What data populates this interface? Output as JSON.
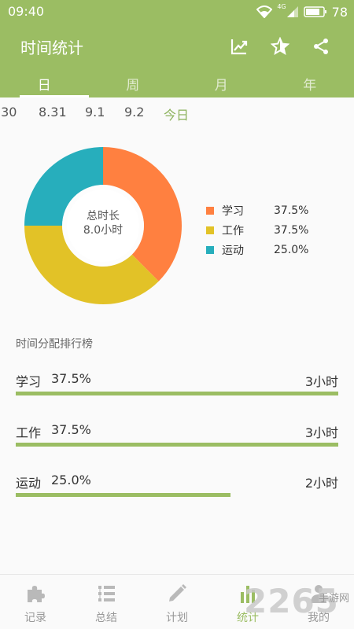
{
  "status_bar": {
    "time": "09:40",
    "network": "4G",
    "battery": "78"
  },
  "app_bar": {
    "title": "时间统计",
    "actions": [
      "trend-chart-icon",
      "star-icon",
      "share-icon"
    ]
  },
  "tabs": [
    {
      "label": "日",
      "active": true
    },
    {
      "label": "周",
      "active": false
    },
    {
      "label": "月",
      "active": false
    },
    {
      "label": "年",
      "active": false
    }
  ],
  "dates": [
    ".30",
    "8.31",
    "9.1",
    "9.2",
    "今日"
  ],
  "colors": {
    "accent": "#9bbd63",
    "study": "#ff8040",
    "work": "#e2c227",
    "sport": "#27aebc"
  },
  "chart_data": {
    "type": "pie",
    "center_label": "总时长",
    "center_value": "8.0小时",
    "slices": [
      {
        "name": "学习",
        "percent": "37.5%",
        "value": 37.5,
        "color": "#ff8040"
      },
      {
        "name": "工作",
        "percent": "37.5%",
        "value": 37.5,
        "color": "#e2c227"
      },
      {
        "name": "运动",
        "percent": "25.0%",
        "value": 25.0,
        "color": "#27aebc"
      }
    ]
  },
  "ranking": {
    "title": "时间分配排行榜",
    "items": [
      {
        "name": "学习",
        "percent": "37.5%",
        "duration": "3小时",
        "fraction": 1.0
      },
      {
        "name": "工作",
        "percent": "37.5%",
        "duration": "3小时",
        "fraction": 1.0
      },
      {
        "name": "运动",
        "percent": "25.0%",
        "duration": "2小时",
        "fraction": 0.667
      }
    ]
  },
  "bottom_nav": [
    {
      "label": "记录",
      "icon": "puzzle-icon",
      "active": false
    },
    {
      "label": "总结",
      "icon": "list-icon",
      "active": false
    },
    {
      "label": "计划",
      "icon": "pencil-icon",
      "active": false
    },
    {
      "label": "统计",
      "icon": "bar-chart-icon",
      "active": true
    },
    {
      "label": "我的",
      "icon": "person-icon",
      "active": false
    }
  ],
  "watermark": {
    "logo": "2265",
    "site": "手游网"
  }
}
